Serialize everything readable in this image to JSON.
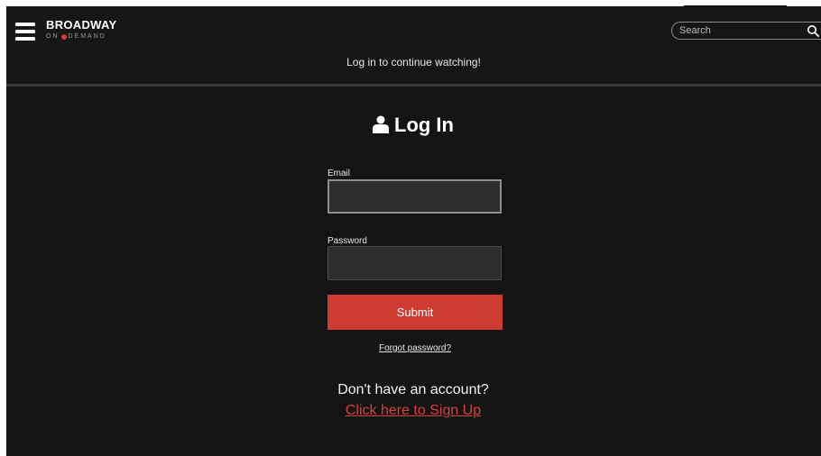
{
  "header": {
    "logo_main": "BROADWAY",
    "logo_sub_left": "ON",
    "logo_sub_right": "DEMAND",
    "tagline": "Log in to continue watching!"
  },
  "search": {
    "placeholder": "Search",
    "value": ""
  },
  "login": {
    "title": "Log In",
    "email_label": "Email",
    "email_value": "",
    "password_label": "Password",
    "password_value": "",
    "submit_label": "Submit",
    "forgot_label": "Forgot password?",
    "no_account_text": "Don't have an account?",
    "signup_label": "Click here to Sign Up"
  },
  "icons": {
    "menu": "hamburger-menu-icon",
    "search": "search-icon",
    "user": "user-icon"
  },
  "colors": {
    "background": "#141414",
    "accent": "#cd3b33",
    "link": "#d4423a",
    "input_bg": "#2d2d2d"
  }
}
